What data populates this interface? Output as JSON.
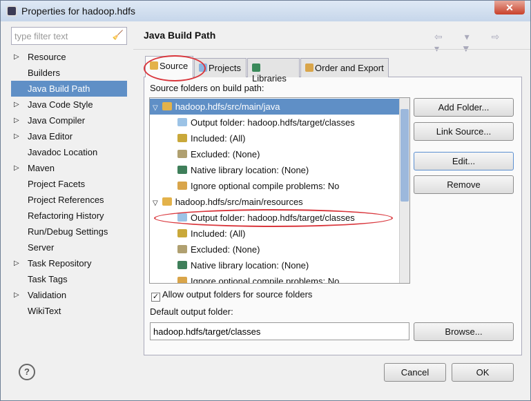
{
  "window": {
    "title": "Properties for hadoop.hdfs",
    "close": "✕"
  },
  "filter": {
    "placeholder": "type filter text"
  },
  "nav": [
    {
      "label": "Resource",
      "expandable": true
    },
    {
      "label": "Builders"
    },
    {
      "label": "Java Build Path",
      "selected": true
    },
    {
      "label": "Java Code Style",
      "expandable": true
    },
    {
      "label": "Java Compiler",
      "expandable": true
    },
    {
      "label": "Java Editor",
      "expandable": true
    },
    {
      "label": "Javadoc Location"
    },
    {
      "label": "Maven",
      "expandable": true
    },
    {
      "label": "Project Facets"
    },
    {
      "label": "Project References"
    },
    {
      "label": "Refactoring History"
    },
    {
      "label": "Run/Debug Settings"
    },
    {
      "label": "Server"
    },
    {
      "label": "Task Repository",
      "expandable": true
    },
    {
      "label": "Task Tags"
    },
    {
      "label": "Validation",
      "expandable": true
    },
    {
      "label": "WikiText"
    }
  ],
  "header": {
    "title": "Java Build Path",
    "arrows": "⇦ ▾ ⇨ ▾ ▼"
  },
  "tabs": [
    "Source",
    "Projects",
    "Libraries",
    "Order and Export"
  ],
  "source": {
    "label": "Source folders on build path:",
    "rows": [
      {
        "text": "hadoop.hdfs/src/main/java",
        "level": 0,
        "selected": true,
        "icon": "source-folder-icon"
      },
      {
        "text": "Output folder: hadoop.hdfs/target/classes",
        "level": 1,
        "icon": "output-folder-icon"
      },
      {
        "text": "Included: (All)",
        "level": 1,
        "icon": "included-icon"
      },
      {
        "text": "Excluded: (None)",
        "level": 1,
        "icon": "excluded-icon"
      },
      {
        "text": "Native library location: (None)",
        "level": 1,
        "icon": "native-library-icon"
      },
      {
        "text": "Ignore optional compile problems: No",
        "level": 1,
        "icon": "ignore-problems-icon"
      },
      {
        "text": "hadoop.hdfs/src/main/resources",
        "level": 0,
        "icon": "source-folder-icon"
      },
      {
        "text": "Output folder: hadoop.hdfs/target/classes",
        "level": 1,
        "icon": "output-folder-icon"
      },
      {
        "text": "Included: (All)",
        "level": 1,
        "icon": "included-icon"
      },
      {
        "text": "Excluded: (None)",
        "level": 1,
        "icon": "excluded-icon"
      },
      {
        "text": "Native library location: (None)",
        "level": 1,
        "icon": "native-library-icon"
      },
      {
        "text": "Ignore optional compile problems: No",
        "level": 1,
        "icon": "ignore-problems-icon"
      }
    ],
    "buttons": [
      "Add Folder...",
      "Link Source...",
      "Edit...",
      "Remove"
    ],
    "allow_output_label": "Allow output folders for source folders",
    "allow_output_checked": true,
    "default_output_label": "Default output folder:",
    "default_output_value": "hadoop.hdfs/target/classes",
    "browse": "Browse..."
  },
  "footer": {
    "help": "?",
    "cancel": "Cancel",
    "ok": "OK"
  },
  "colors": {
    "selection": "#5f8fc6",
    "annotation": "#d9363c"
  }
}
